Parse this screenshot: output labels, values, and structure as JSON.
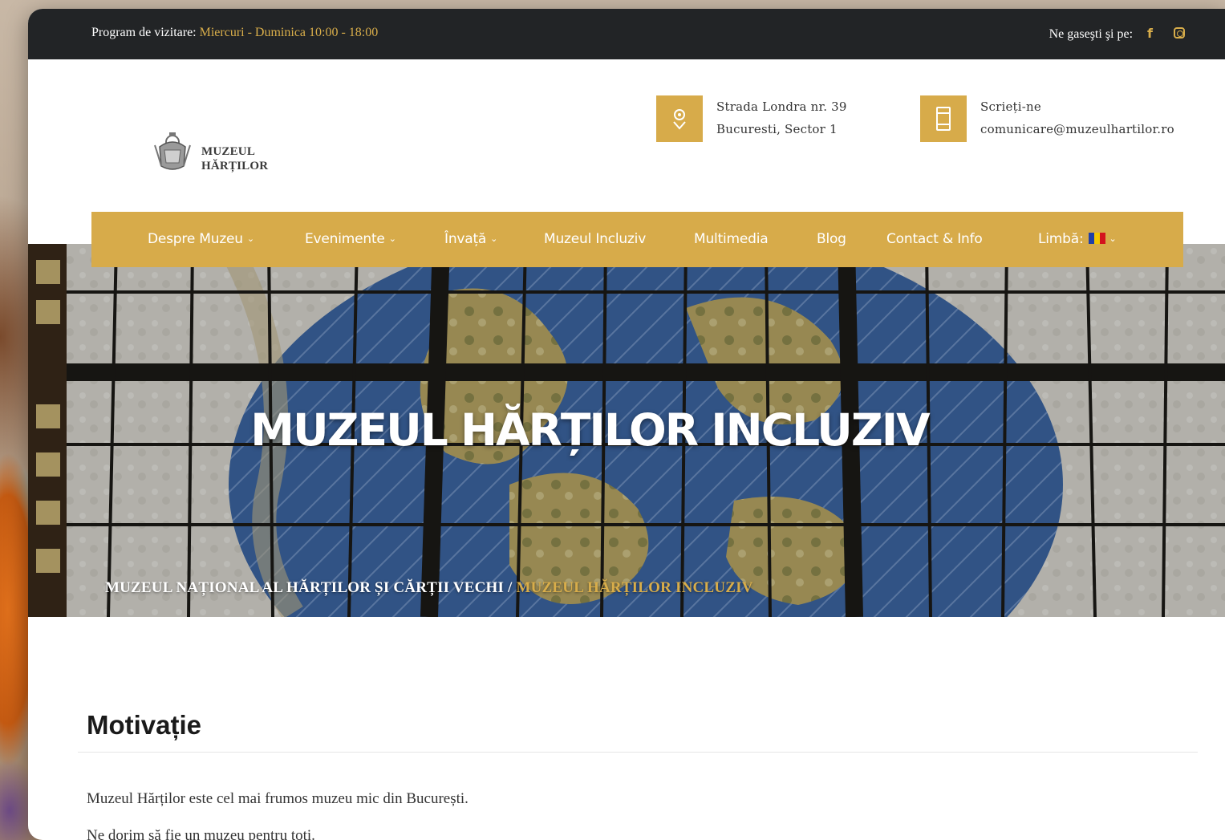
{
  "topbar": {
    "hours_label": "Program de vizitare:",
    "hours_value": "Miercuri - Duminica 10:00 - 18:00",
    "social_label": "Ne gaseşti şi pe:",
    "facebook_icon": "f"
  },
  "logo": {
    "line1": "MUZEUL",
    "line2": "HĂRȚILOR"
  },
  "contact": {
    "address_line1": "Strada Londra nr. 39",
    "address_line2": "Bucuresti, Sector 1",
    "write_label": "Scrieți-ne",
    "email": "comunicare@muzeulhartilor.ro"
  },
  "nav": {
    "items": [
      {
        "label": "Despre Muzeu",
        "chevron": "⌄"
      },
      {
        "label": "Evenimente",
        "chevron": "⌄"
      },
      {
        "label": "Învață",
        "chevron": "⌄"
      },
      {
        "label": "Muzeul Incluziv"
      },
      {
        "label": "Multimedia"
      },
      {
        "label": "Blog"
      },
      {
        "label": "Contact & Info"
      },
      {
        "label": "Limbă:",
        "chevron": "⌄"
      }
    ]
  },
  "hero": {
    "title": "MUZEUL HĂRȚILOR INCLUZIV",
    "breadcrumb_home": "MUZEUL NAȚIONAL AL HĂRȚILOR ȘI CĂRȚII VECHI",
    "breadcrumb_sep": " / ",
    "breadcrumb_current": "MUZEUL HĂRȚILOR INCLUZIV"
  },
  "content": {
    "heading": "Motivație",
    "p1": "Muzeul Hărților este cel mai frumos muzeu mic din București.",
    "p2": "Ne dorim să fie un muzeu pentru toți."
  },
  "colors": {
    "accent": "#d7ab4a",
    "topbar": "#222426"
  }
}
